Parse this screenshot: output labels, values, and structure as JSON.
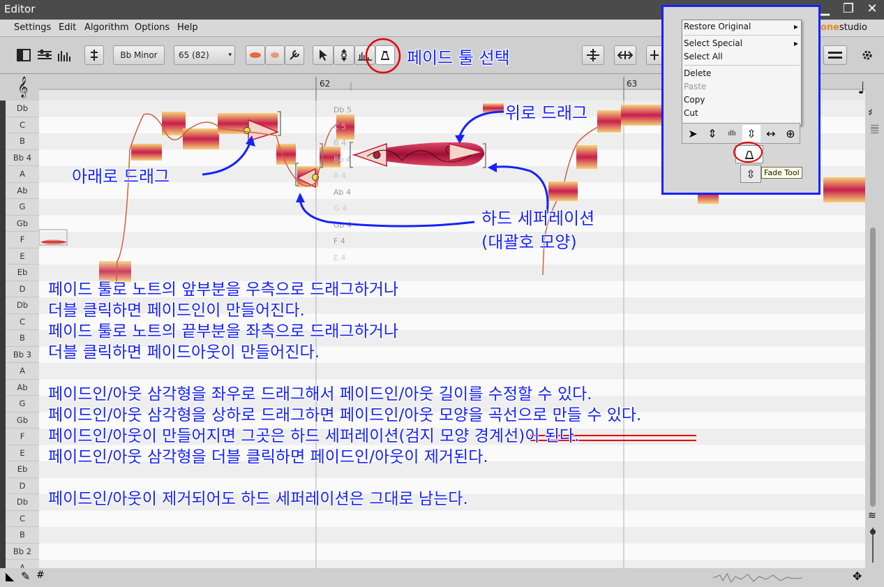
{
  "window": {
    "title": "Editor"
  },
  "menu": [
    "Settings",
    "Edit",
    "Algorithm",
    "Options",
    "Help"
  ],
  "toolbar": {
    "scale": "Bb Minor",
    "tempo": "65 (82)"
  },
  "ruler": {
    "bar1": "62",
    "bar2": "63"
  },
  "brand": "studio",
  "brand_prefix": "one",
  "pitches": [
    "Db",
    "C",
    "B",
    "Bb 4",
    "A",
    "Ab",
    "G",
    "Gb",
    "F",
    "E",
    "Eb",
    "D",
    "Db",
    "C",
    "B",
    "Bb 3",
    "A",
    "Ab",
    "G",
    "Gb",
    "F",
    "E",
    "Eb",
    "D",
    "Db",
    "C",
    "B",
    "Bb 2",
    "A"
  ],
  "note_labels": [
    "Db 5",
    "C 5",
    "B 4",
    "Bb 4",
    "A 4",
    "Ab 4",
    "G 4",
    "Gb 4",
    "F 4",
    "E 4"
  ],
  "context_menu": {
    "items": [
      "Restore Original",
      "Select Special",
      "Select All",
      "Delete",
      "Paste",
      "Copy",
      "Cut"
    ],
    "tooltip": "Fade Tool"
  },
  "annotations": {
    "select_fade_tool": "페이드 툴 선택",
    "drag_up": "위로 드래그",
    "drag_down": "아래로 드래그",
    "hard_sep_1": "하드 세퍼레이션",
    "hard_sep_2": "(대괄호 모양)",
    "body": [
      "페이드 툴로 노트의 앞부분을 우측으로 드래그하거나",
      "더블 클릭하면 페이드인이 만들어진다.",
      "페이드 툴로 노트의 끝부분을 좌측으로 드래그하거나",
      "더블 클릭하면 페이드아웃이 만들어진다.",
      "",
      "페이드인/아웃 삼각형을 좌우로 드래그해서 페이드인/아웃 길이를 수정할 수 있다.",
      "페이드인/아웃 삼각형을 상하로 드래그하면 페이드인/아웃 모양을 곡선으로 만들 수 있다.",
      "페이드인/아웃이 만들어지면 그곳은 하드 세퍼레이션",
      "",
      "페이드인/아웃 삼각형을 더블 클릭하면 페이드인/아웃이 제거된다.",
      "",
      "페이드인/아웃이 제거되어도 하드 세퍼레이션은 그대로 남는다."
    ],
    "struck": "(검지 모양 경계선)",
    "after_struck": "이 된다."
  },
  "colors": {
    "annotation": "#1421ff",
    "highlight": "#e00000",
    "note": "#c0184a"
  }
}
